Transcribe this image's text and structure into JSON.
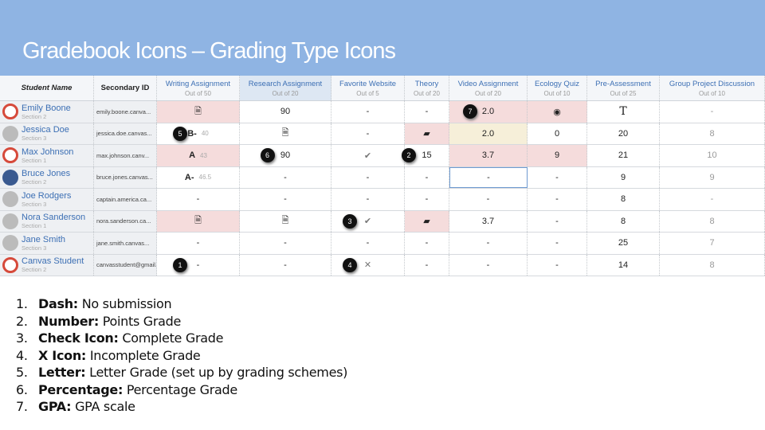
{
  "title": "Gradebook Icons – Grading Type Icons",
  "columns": [
    {
      "label": "Student Name",
      "style": "b i"
    },
    {
      "label": "Secondary ID",
      "style": "b"
    },
    {
      "label": "Writing Assignment",
      "sub": "Out of 50"
    },
    {
      "label": "Research Assignment",
      "sub": "Out of 20",
      "style": "sel"
    },
    {
      "label": "Favorite Website",
      "sub": "Out of 5"
    },
    {
      "label": "Theory",
      "sub": "Out of 20"
    },
    {
      "label": "Video Assignment",
      "sub": "Out of 20"
    },
    {
      "label": "Ecology Quiz",
      "sub": "Out of 10"
    },
    {
      "label": "Pre-Assessment",
      "sub": "Out of 25"
    },
    {
      "label": "Group Project Discussion",
      "sub": "Out of 10"
    }
  ],
  "students": [
    {
      "name": "Emily Boone",
      "section": "Section 2",
      "avatar": "canvas",
      "sid": "emily.boone.canva...",
      "cells": [
        {
          "icon": "document",
          "bg": "pink"
        },
        {
          "t": "90"
        },
        {
          "t": "-"
        },
        {
          "t": "-"
        },
        {
          "t": "2.0",
          "bg": "pink",
          "badge": "7"
        },
        {
          "icon": "target",
          "bg": "pink"
        },
        {
          "icon": "text"
        },
        {
          "t": "-",
          "muted": true
        }
      ]
    },
    {
      "name": "Jessica Doe",
      "section": "Section 3",
      "avatar": "default",
      "sid": "jessica.doe.canvas...",
      "cells": [
        {
          "t": "B-",
          "small": "40",
          "badge": "5"
        },
        {
          "icon": "document"
        },
        {
          "t": "-"
        },
        {
          "icon": "comment",
          "bg": "pink"
        },
        {
          "t": "2.0",
          "bg": "yellow"
        },
        {
          "t": "0"
        },
        {
          "t": "20"
        },
        {
          "t": "8",
          "muted": true
        }
      ]
    },
    {
      "name": "Max Johnson",
      "section": "Section 1",
      "avatar": "canvas",
      "sid": "max.johnson.canv...",
      "cells": [
        {
          "t": "A",
          "small": "43",
          "bg": "pink"
        },
        {
          "t": "90",
          "badge": "6"
        },
        {
          "icon": "check"
        },
        {
          "t": "15",
          "badge": "2"
        },
        {
          "t": "3.7",
          "bg": "pink"
        },
        {
          "t": "9",
          "bg": "pink"
        },
        {
          "t": "21"
        },
        {
          "t": "10",
          "muted": true
        }
      ]
    },
    {
      "name": "Bruce Jones",
      "section": "Section 2",
      "avatar": "photo",
      "sid": "bruce.jones.canvas...",
      "cells": [
        {
          "t": "A-",
          "small": "46.5"
        },
        {
          "t": "-"
        },
        {
          "t": "-"
        },
        {
          "t": "-"
        },
        {
          "t": "-",
          "bg": "sel"
        },
        {
          "t": "-"
        },
        {
          "t": "9"
        },
        {
          "t": "9",
          "muted": true
        }
      ]
    },
    {
      "name": "Joe Rodgers",
      "section": "Section 3",
      "avatar": "default",
      "sid": "captain.america.ca...",
      "cells": [
        {
          "t": "-"
        },
        {
          "t": "-"
        },
        {
          "t": "-"
        },
        {
          "t": "-"
        },
        {
          "t": "-"
        },
        {
          "t": "-"
        },
        {
          "t": "8"
        },
        {
          "t": "-",
          "muted": true
        }
      ]
    },
    {
      "name": "Nora Sanderson",
      "section": "Section 1",
      "avatar": "default",
      "sid": "nora.sanderson.ca...",
      "cells": [
        {
          "icon": "document",
          "bg": "pink"
        },
        {
          "icon": "document"
        },
        {
          "icon": "check",
          "badge": "3"
        },
        {
          "icon": "comment",
          "bg": "pink"
        },
        {
          "t": "3.7"
        },
        {
          "t": "-"
        },
        {
          "t": "8"
        },
        {
          "t": "8",
          "muted": true
        }
      ]
    },
    {
      "name": "Jane Smith",
      "section": "Section 3",
      "avatar": "default",
      "sid": "jane.smith.canvas...",
      "cells": [
        {
          "t": "-"
        },
        {
          "t": "-"
        },
        {
          "t": "-"
        },
        {
          "t": "-"
        },
        {
          "t": "-"
        },
        {
          "t": "-"
        },
        {
          "t": "25"
        },
        {
          "t": "7",
          "muted": true
        }
      ]
    },
    {
      "name": "Canvas Student",
      "section": "Section 2",
      "avatar": "canvas",
      "sid": "canvasstudent@gmail...",
      "cells": [
        {
          "t": "-",
          "badge": "1"
        },
        {
          "t": "-"
        },
        {
          "icon": "x",
          "badge": "4"
        },
        {
          "t": "-"
        },
        {
          "t": "-"
        },
        {
          "t": "-"
        },
        {
          "t": "14"
        },
        {
          "t": "8",
          "muted": true
        }
      ]
    }
  ],
  "legend": [
    {
      "num": "1.",
      "term": "Dash:",
      "desc": " No submission"
    },
    {
      "num": "2.",
      "term": "Number:",
      "desc": " Points Grade"
    },
    {
      "num": "3.",
      "term": "Check Icon:",
      "desc": " Complete Grade"
    },
    {
      "num": "4.",
      "term": "X Icon:",
      "desc": " Incomplete Grade"
    },
    {
      "num": "5.",
      "term": "Letter:",
      "desc": " Letter Grade (set up by grading schemes)"
    },
    {
      "num": "6.",
      "term": "Percentage:",
      "desc": " Percentage Grade"
    },
    {
      "num": "7.",
      "term": "GPA:",
      "desc": " GPA scale"
    }
  ]
}
